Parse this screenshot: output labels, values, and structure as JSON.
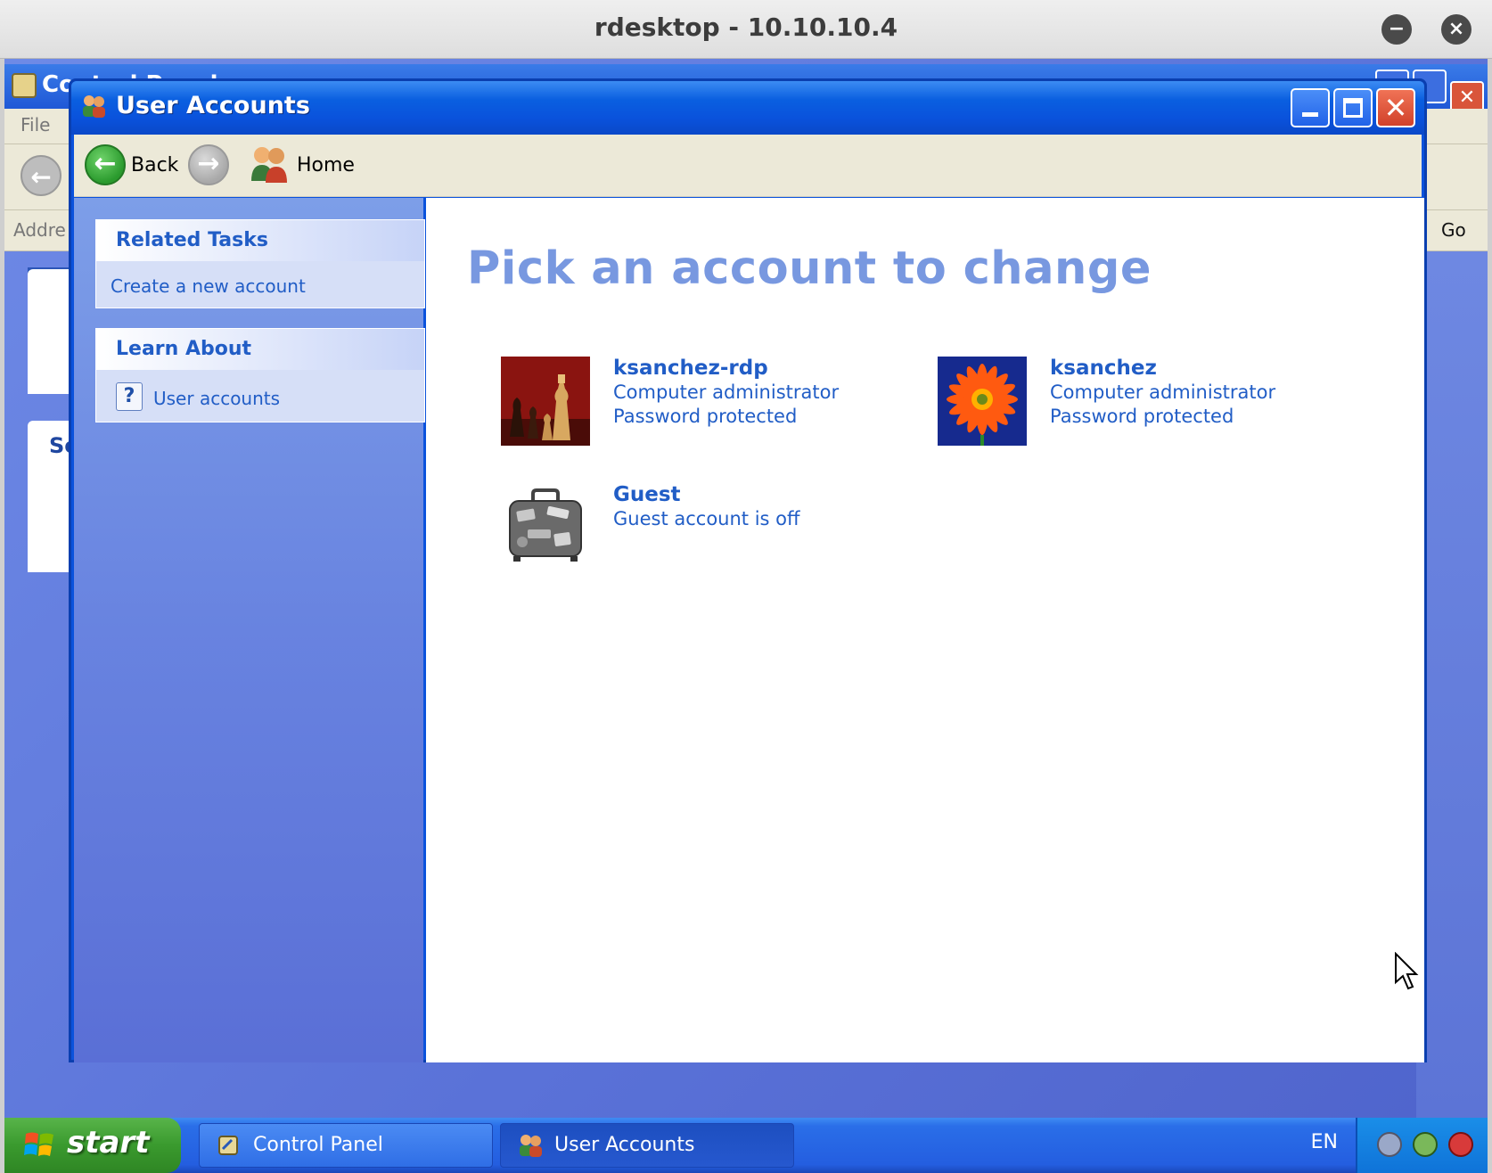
{
  "rdesktop": {
    "title": "rdesktop - 10.10.10.4",
    "minimize_glyph": "−",
    "close_glyph": "×"
  },
  "background_window": {
    "title": "Control Panel",
    "menu_file": "File",
    "address_label": "Addre",
    "go_label": "Go",
    "side_label": "Se"
  },
  "window": {
    "title": "User Accounts",
    "minimize_icon": "minimize-icon",
    "maximize_icon": "maximize-icon",
    "close_glyph": "✕"
  },
  "toolbar": {
    "back_label": "Back",
    "back_glyph": "←",
    "forward_glyph": "→",
    "home_label": "Home"
  },
  "sidebar": {
    "related_tasks": {
      "title": "Related Tasks",
      "items": [
        {
          "label": "Create a new account"
        }
      ]
    },
    "learn_about": {
      "title": "Learn About",
      "items": [
        {
          "label": "User accounts",
          "icon": "help-icon",
          "glyph": "?"
        }
      ]
    }
  },
  "main": {
    "heading": "Pick an account to change",
    "accounts": [
      {
        "name": "ksanchez-rdp",
        "line1": "Computer administrator",
        "line2": "Password protected",
        "picture": "chess-picture"
      },
      {
        "name": "ksanchez",
        "line1": "Computer administrator",
        "line2": "Password protected",
        "picture": "flower-picture"
      },
      {
        "name": "Guest",
        "line1": "Guest account is off",
        "line2": "",
        "picture": "suitcase-picture"
      }
    ]
  },
  "taskbar": {
    "start_label": "start",
    "tasks": [
      {
        "label": "Control Panel",
        "active": false
      },
      {
        "label": "User Accounts",
        "active": true
      }
    ],
    "language": "EN"
  },
  "colors": {
    "xp_blue": "#0a52dc",
    "link_blue": "#215dc6",
    "heading_blue": "#7898e0",
    "start_green": "#3a9a2e"
  }
}
